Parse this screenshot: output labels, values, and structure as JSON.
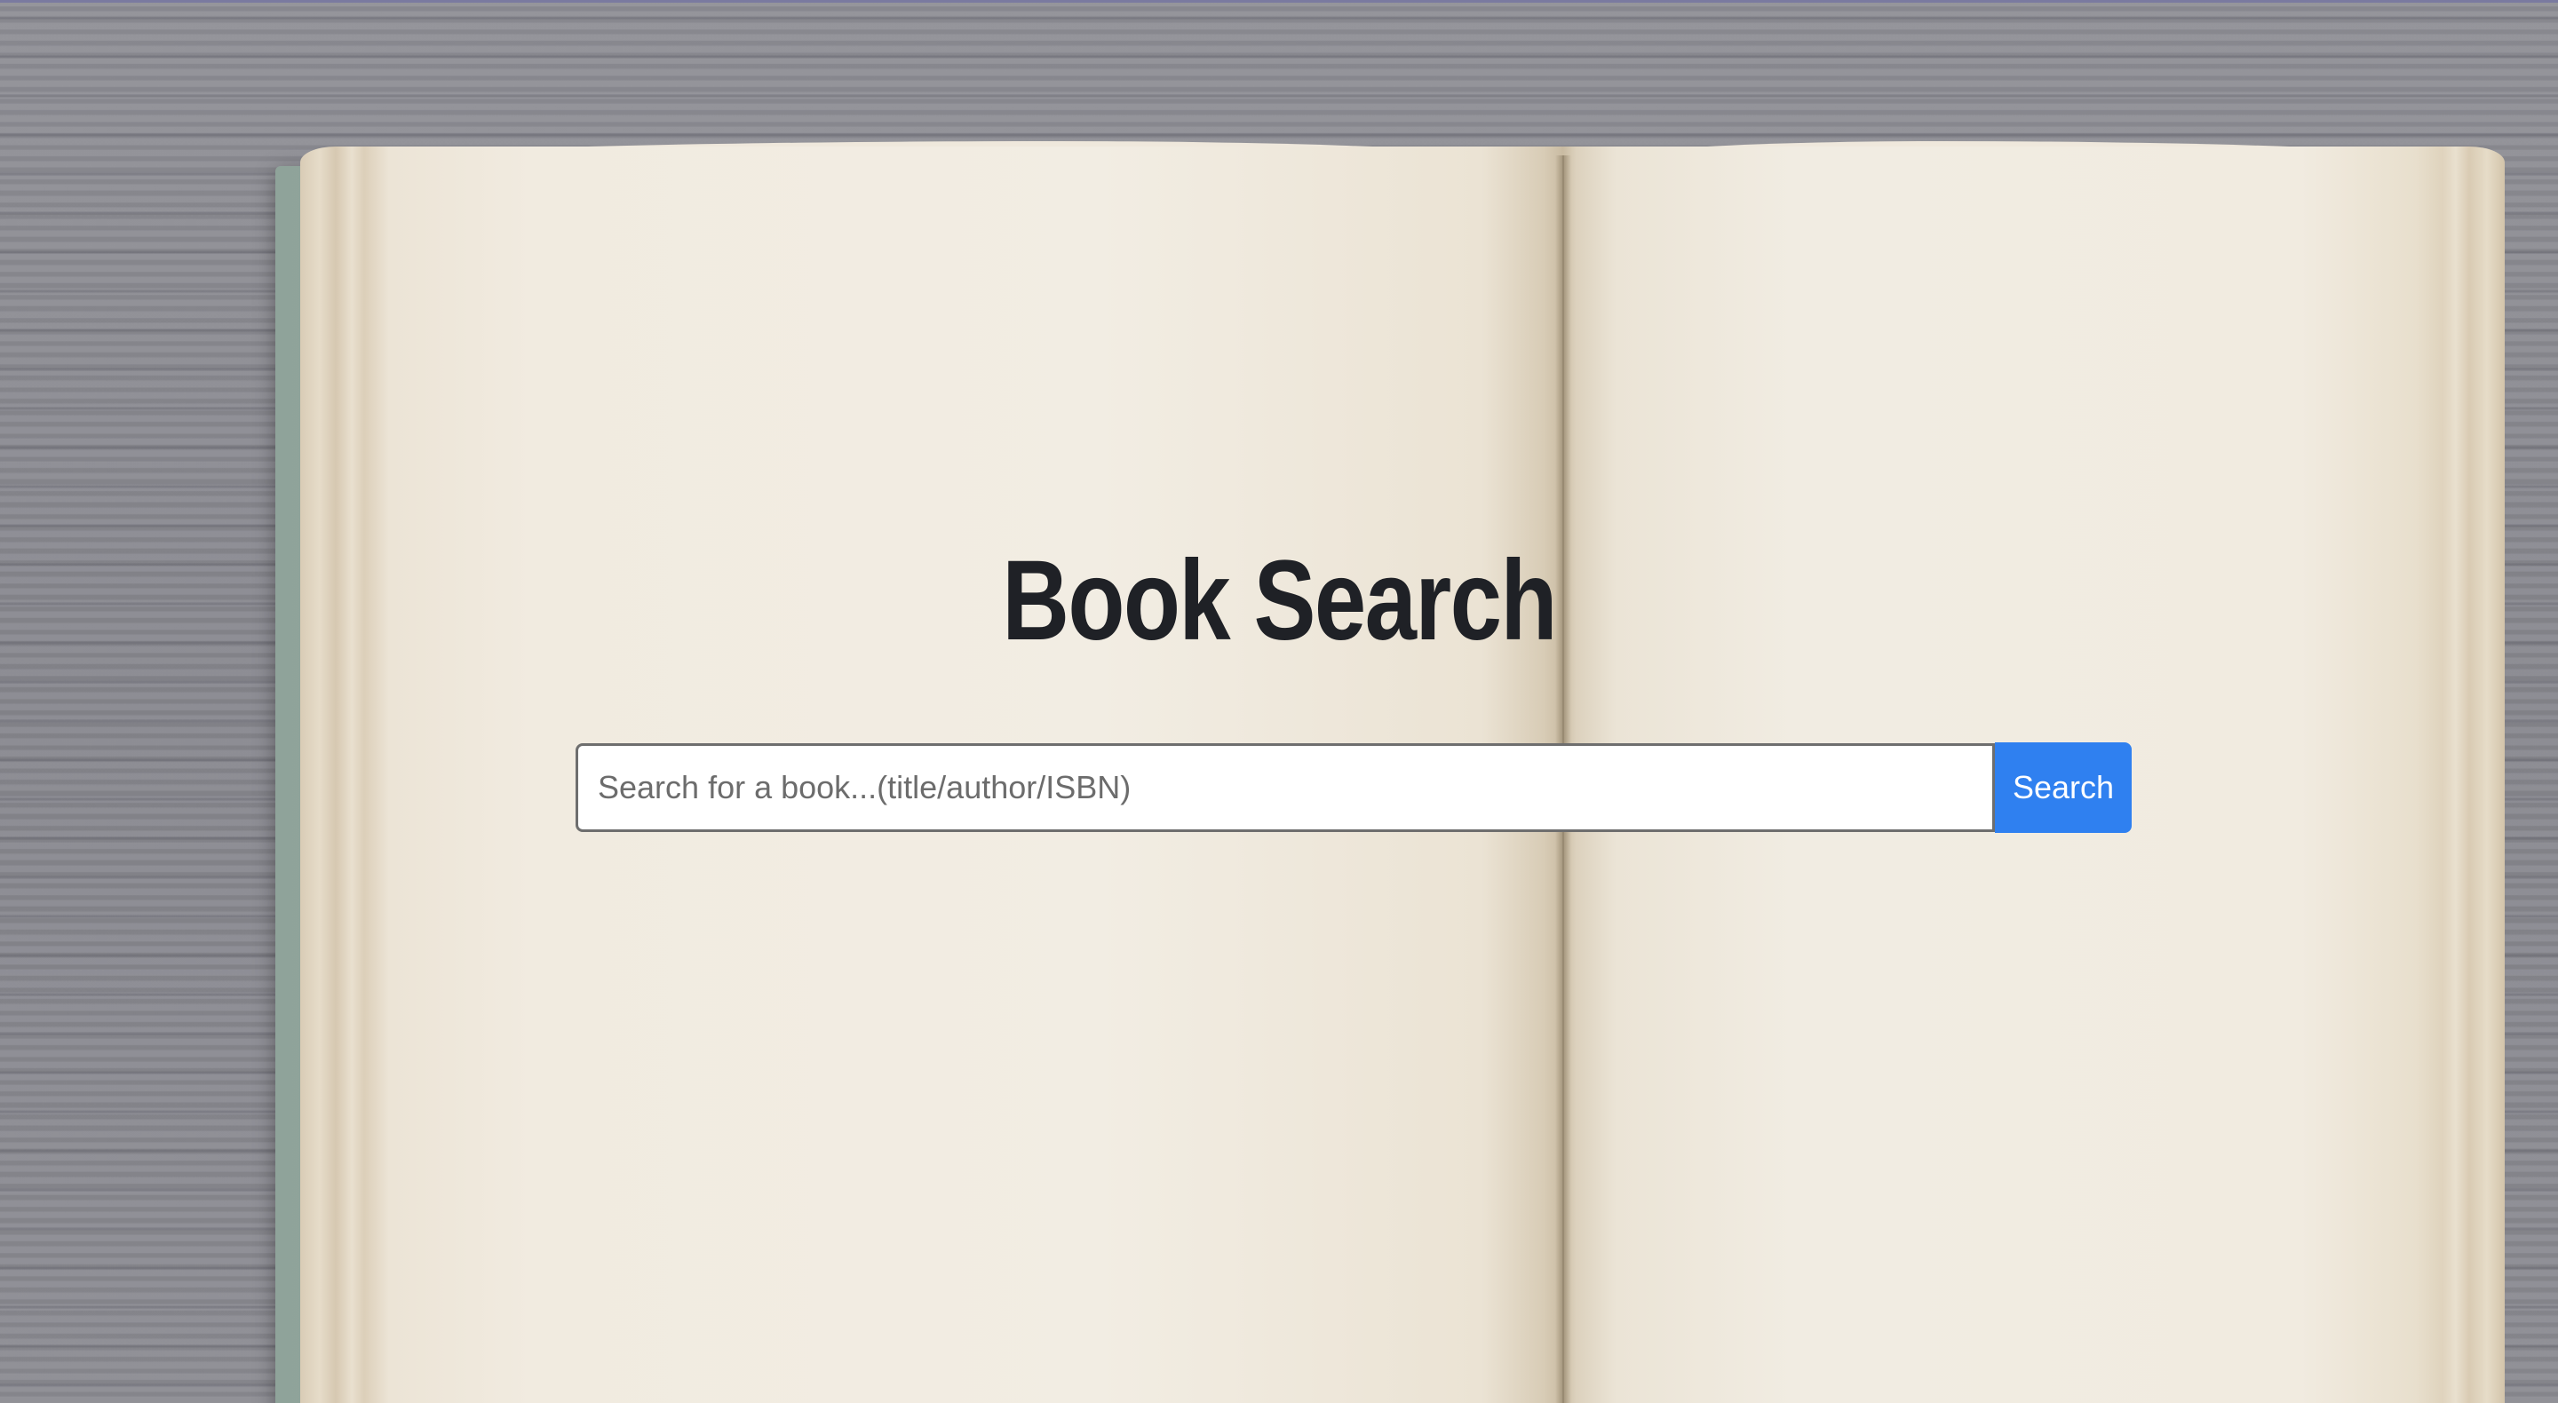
{
  "page": {
    "title": "Book Search"
  },
  "search": {
    "placeholder": "Search for a book...(title/author/ISBN)",
    "value": "",
    "button_label": "Search"
  },
  "colors": {
    "button_background": "#2f80f0",
    "button_text": "#ffffff",
    "title_text": "#1f2126",
    "desk_background": "#8b8b91",
    "page_paper": "#efe8dc",
    "book_cover": "#9fb2a8"
  }
}
